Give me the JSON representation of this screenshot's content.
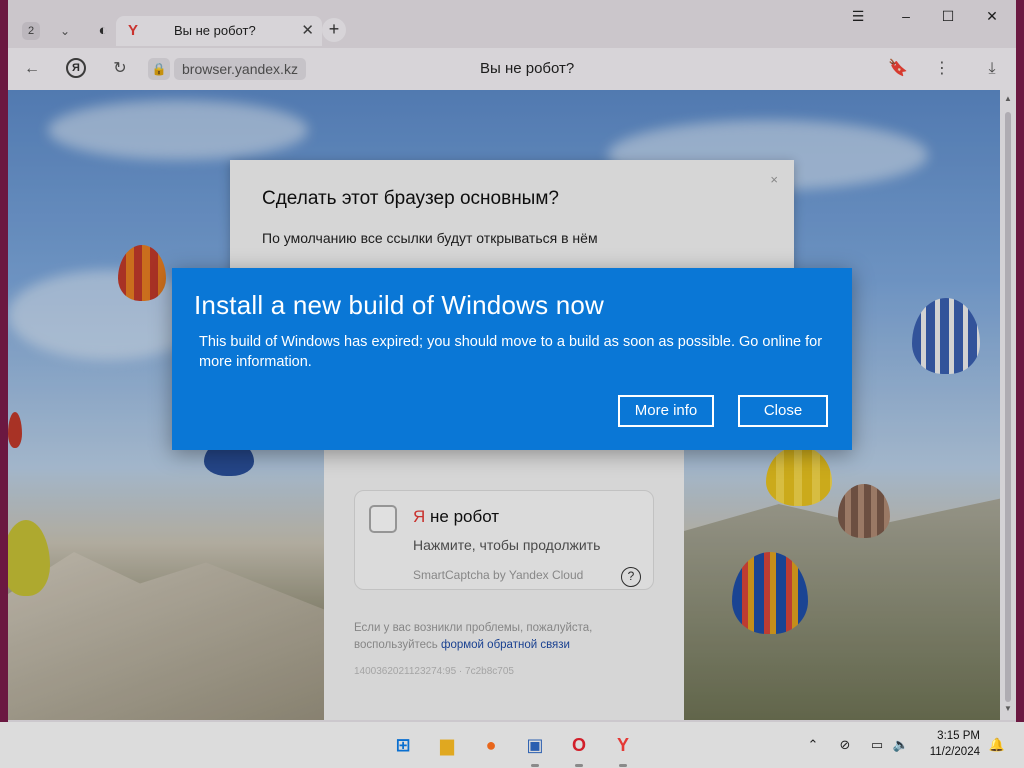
{
  "browser": {
    "tab_count": "2",
    "tab": {
      "title": "Вы не робот?",
      "favicon": "Y"
    },
    "url": "browser.yandex.kz",
    "page_title": "Вы не робот?"
  },
  "default_prompt": {
    "title": "Сделать этот браузер основным?",
    "text": "По умолчанию все ссылки будут открываться в нём",
    "close": "×"
  },
  "captcha": {
    "title_brand": "Я",
    "title_rest": " не робот",
    "subtitle": "Нажмите, чтобы продолжить",
    "brand": "SmartCaptcha by Yandex Cloud",
    "help": "?",
    "note_prefix": "Если у вас возникли проблемы, пожалуйста, воспользуйтесь ",
    "note_link": "формой обратной связи",
    "request_id": "1400362021123274:95 · 7c2b8c705"
  },
  "dialog": {
    "title": "Install a new build of Windows now",
    "message": "This build of Windows has expired; you should move to a build as soon as possible. Go online for more information.",
    "more_info": "More info",
    "close": "Close"
  },
  "taskbar": {
    "time": "3:15 PM",
    "date": "11/2/2024"
  },
  "colors": {
    "dialog_bg": "#0a77d6",
    "accent_red": "#e53935"
  }
}
